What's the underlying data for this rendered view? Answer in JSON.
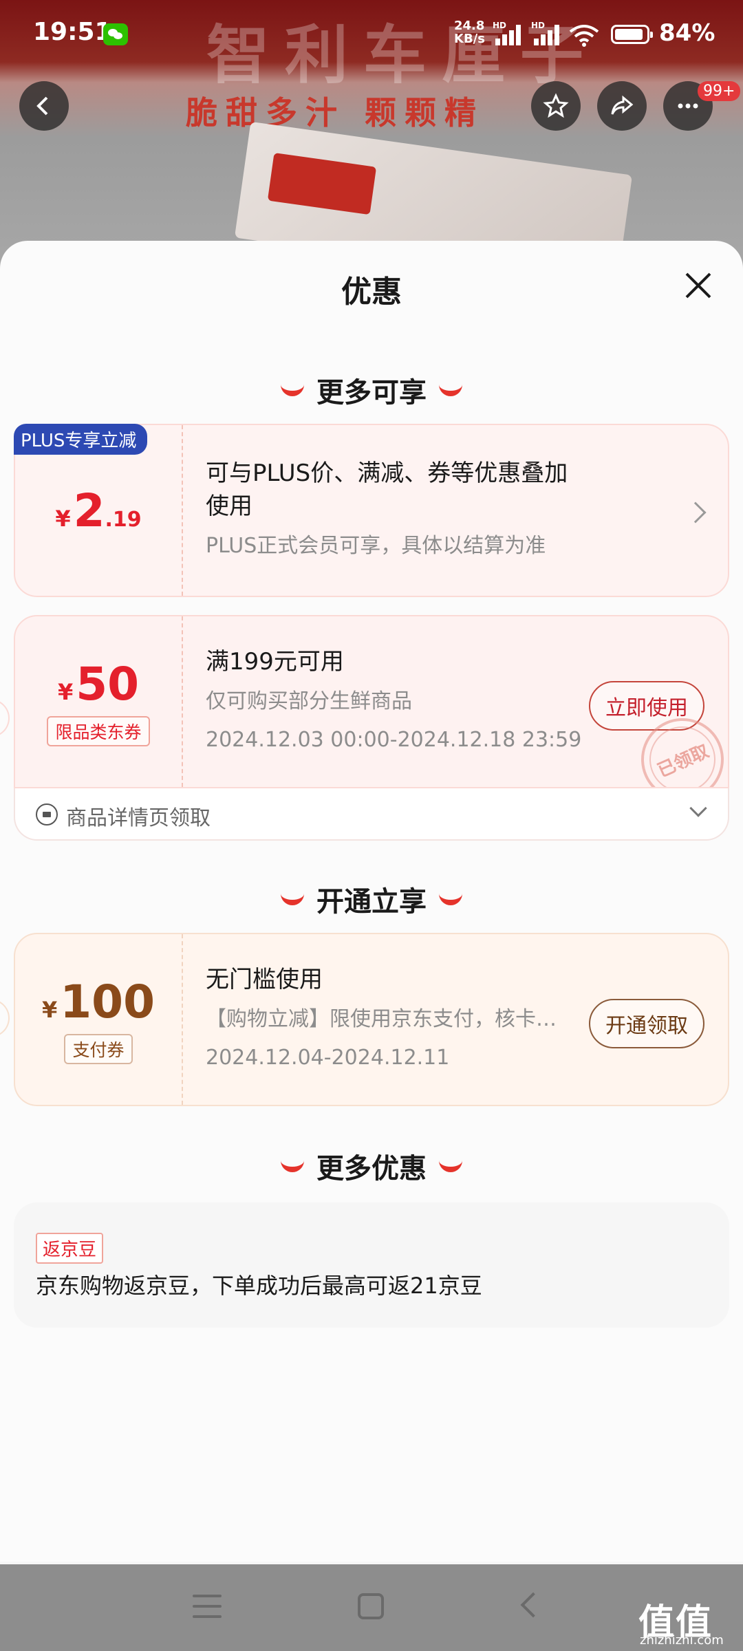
{
  "status_bar": {
    "time": "19:51",
    "net_speed_value": "24.8",
    "net_speed_unit": "KB/s",
    "hd_label": "HD",
    "battery": "84%",
    "icons": [
      "wechat-icon",
      "signal-icon",
      "wifi-icon",
      "battery-icon"
    ]
  },
  "background": {
    "banner_title": "智利车厘子",
    "banner_subtitle": "脆甜多汁 颗颗精",
    "cart_badge": "99+"
  },
  "sheet": {
    "title": "优惠",
    "section1_title": "更多可享",
    "plus_card": {
      "badge": "PLUS专享立减",
      "yen": "¥",
      "price_int": "2",
      "price_dec": ".19",
      "main_line1": "可与PLUS价、满减、券等优惠叠加",
      "main_line2": "使用",
      "sub": "PLUS正式会员可享，具体以结算为准"
    },
    "coupon_card": {
      "yen": "¥",
      "price": "50",
      "tag": "限品类东券",
      "main": "满199元可用",
      "sub": "仅可购买部分生鲜商品",
      "date": "2024.12.03 00:00-2024.12.18 23:59",
      "button": "立即使用",
      "stamp": "已领取",
      "footer": "商品详情页领取"
    },
    "section2_title": "开通立享",
    "pay_card": {
      "yen": "¥",
      "price": "100",
      "tag": "支付券",
      "main": "无门槛使用",
      "sub": "【购物立减】限使用京东支付，核卡…",
      "date": "2024.12.04-2024.12.11",
      "button": "开通领取"
    },
    "section3_title": "更多优惠",
    "bean_card": {
      "tag": "返京豆",
      "text": "京东购物返京豆，下单成功后最高可返21京豆"
    }
  },
  "watermark": {
    "logo": "值值值",
    "url": "zhizhizhi.com"
  },
  "colors": {
    "accent_red": "#e4202c",
    "plus_blue": "#2d49b3",
    "brown": "#8a4a1a"
  }
}
